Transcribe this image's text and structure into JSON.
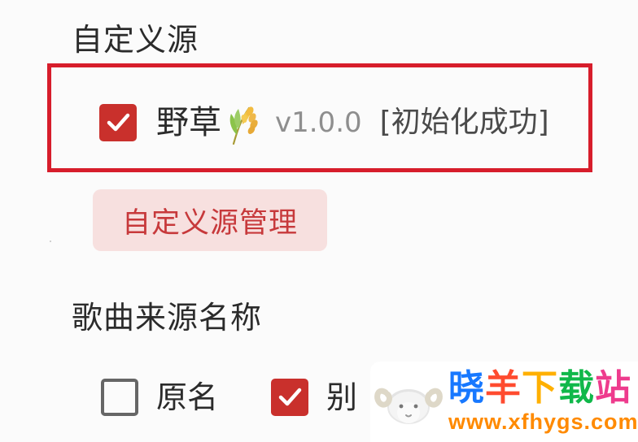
{
  "sections": {
    "custom_source_title": "自定义源",
    "song_source_name_title": "歌曲来源名称"
  },
  "custom_source": {
    "enabled": true,
    "name": "野草",
    "icon": "rice-ear-icon",
    "version": "v1.0.0",
    "status": "[初始化成功]"
  },
  "buttons": {
    "manage": "自定义源管理"
  },
  "song_source_options": [
    {
      "label": "原名",
      "checked": false
    },
    {
      "label": "别",
      "checked": true
    }
  ],
  "watermark": {
    "name_chars": [
      "晓",
      "羊",
      "下",
      "载",
      "站"
    ],
    "url": "www.xfhygs.com",
    "icon": "sheep-logo"
  },
  "colors": {
    "highlight": "#d71d2b",
    "checked": "#c9302c",
    "button_background": "#f7e0df",
    "button_text": "#c7393b"
  }
}
